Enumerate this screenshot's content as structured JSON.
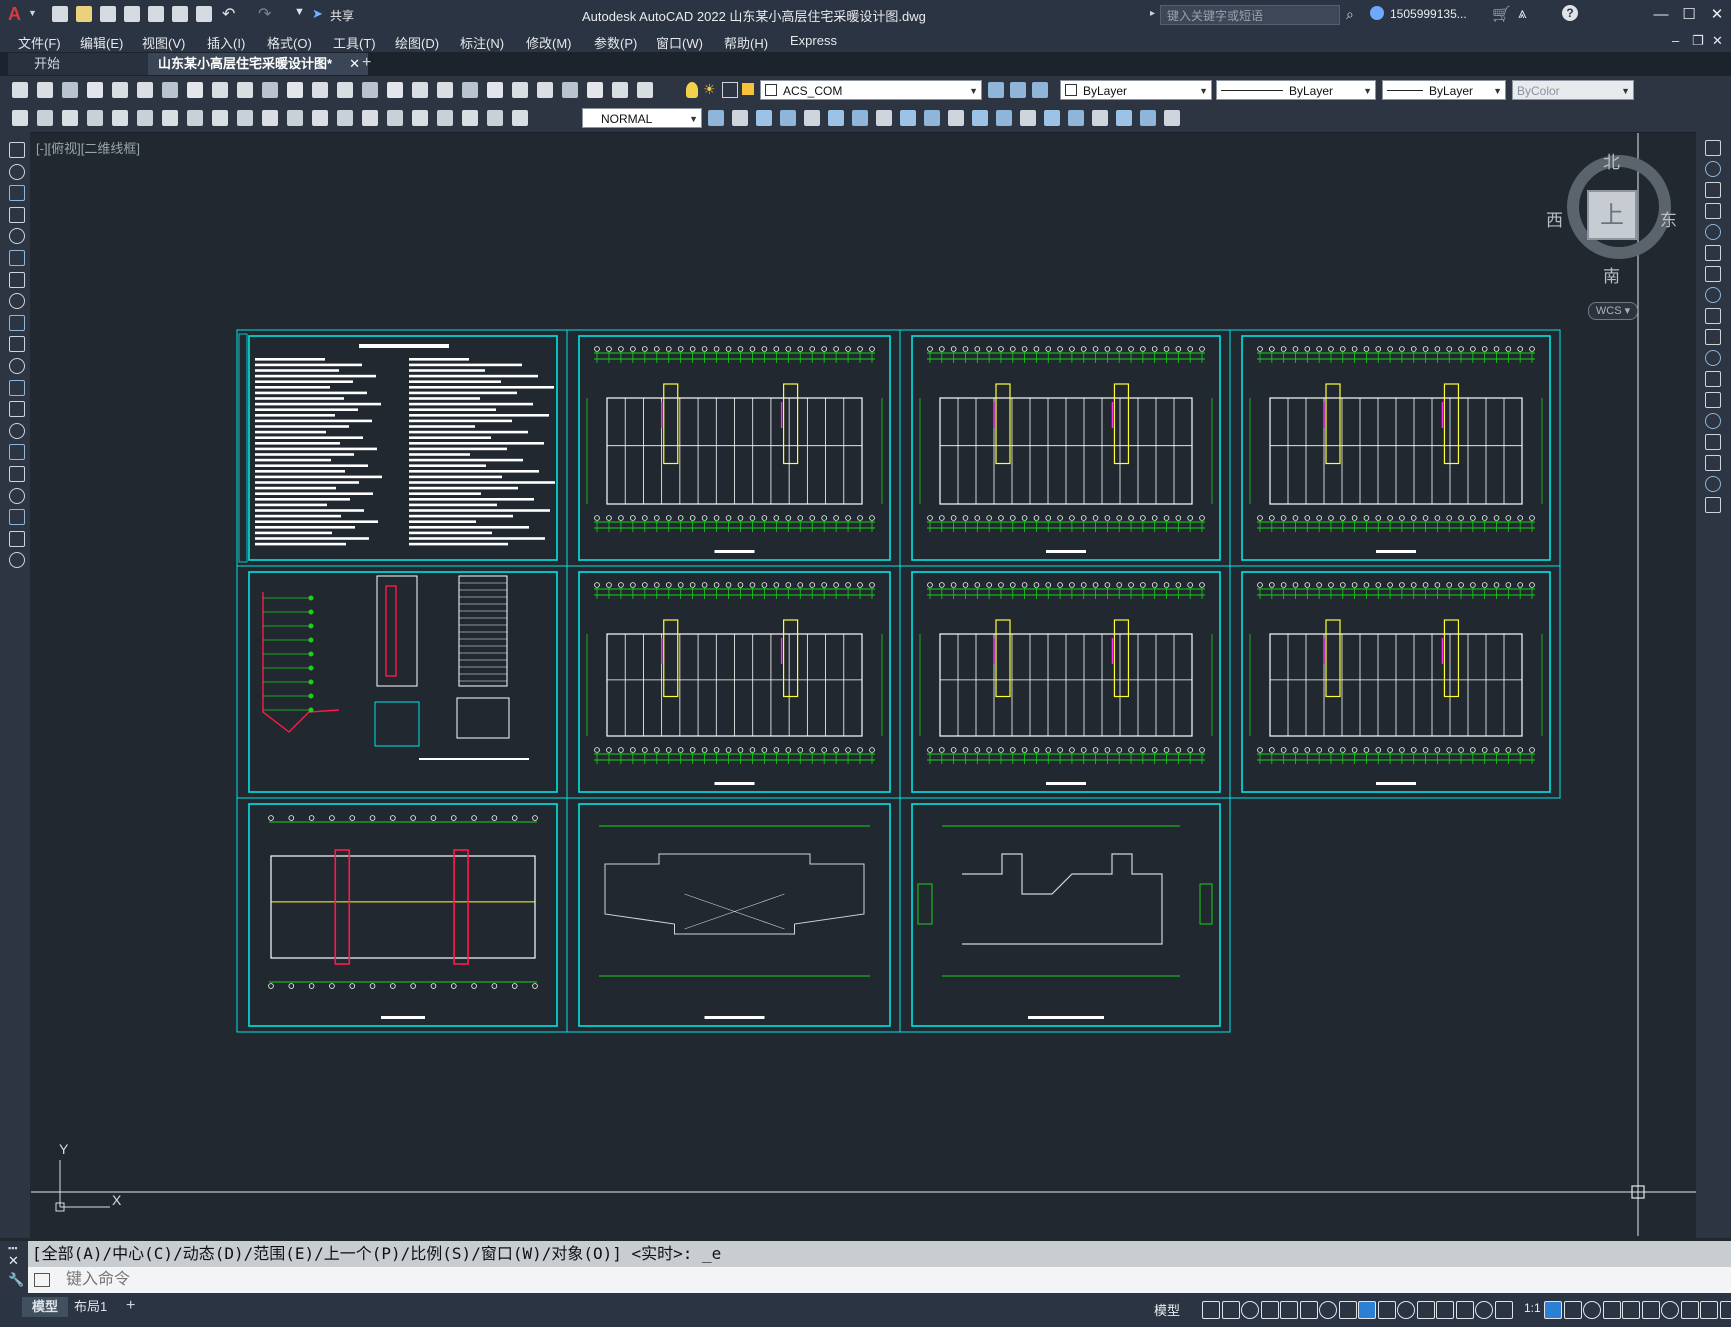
{
  "title_bar": {
    "app_title": "Autodesk AutoCAD 2022    山东某小高层住宅采暖设计图.dwg",
    "share_label": "共享",
    "search_placeholder": "键入关键字或短语",
    "user_name": "1505999135..."
  },
  "menu": [
    "文件(F)",
    "编辑(E)",
    "视图(V)",
    "插入(I)",
    "格式(O)",
    "工具(T)",
    "绘图(D)",
    "标注(N)",
    "修改(M)",
    "参数(P)",
    "窗口(W)",
    "帮助(H)",
    "Express"
  ],
  "tabs": {
    "start": "开始",
    "document": "山东某小高层住宅采暖设计图*"
  },
  "properties": {
    "layer": "ACS_COM",
    "color": "ByLayer",
    "linetype": "ByLayer",
    "lineweight": "ByLayer",
    "plotstyle": "ByColor",
    "text_style": "NORMAL"
  },
  "viewport_label": "[-][俯视][二维线框]",
  "viewcube": {
    "north": "北",
    "south": "南",
    "east": "东",
    "west": "西",
    "face": "上",
    "wcs": "WCS"
  },
  "ucs": {
    "x_label": "X",
    "y_label": "Y"
  },
  "command": {
    "history": "[全部(A)/中心(C)/动态(D)/范围(E)/上一个(P)/比例(S)/窗口(W)/对象(O)] <实时>: _e",
    "placeholder": "键入命令"
  },
  "status_bar": {
    "layout_tabs": [
      "模型",
      "布局1"
    ],
    "model_label": "模型",
    "scale": "1:1"
  },
  "colors": {
    "frame": "#00e5e5",
    "grid_line": "#19d219",
    "wall": "#ffffff",
    "pipe_red": "#ff1a4a",
    "pipe_yellow": "#ffff33",
    "magenta": "#ff33ff"
  }
}
